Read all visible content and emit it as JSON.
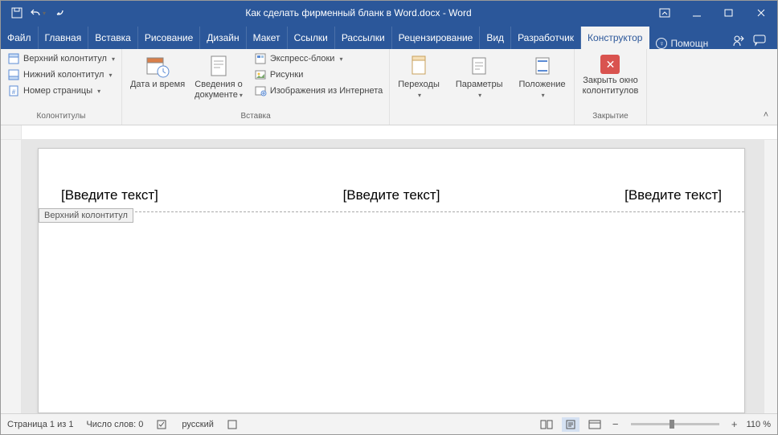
{
  "title": "Как сделать фирменный бланк в Word.docx  -  Word",
  "tabs": {
    "file": "Файл",
    "home": "Главная",
    "insert": "Вставка",
    "draw": "Рисование",
    "design": "Дизайн",
    "layout": "Макет",
    "refs": "Ссылки",
    "mail": "Рассылки",
    "review": "Рецензирование",
    "view": "Вид",
    "dev": "Разработчик",
    "constructor": "Конструктор"
  },
  "help_placeholder": "Помощн",
  "ribbon": {
    "hf": {
      "header": "Верхний колонтитул",
      "footer": "Нижний колонтитул",
      "pagenum": "Номер страницы",
      "group": "Колонтитулы"
    },
    "ins": {
      "datetime": "Дата и время",
      "docinfo": "Сведения о документе",
      "quick": "Экспресс-блоки",
      "pics": "Рисунки",
      "online": "Изображения из Интернета",
      "group": "Вставка"
    },
    "nav": {
      "goto": "Переходы",
      "params": "Параметры",
      "pos": "Положение"
    },
    "close": {
      "label1": "Закрыть окно",
      "label2": "колонтитулов",
      "group": "Закрытие"
    }
  },
  "doc": {
    "ph_left": "[Введите текст]",
    "ph_center": "[Введите текст]",
    "ph_right": "[Введите текст]",
    "hf_tag": "Верхний колонтитул"
  },
  "status": {
    "page": "Страница 1 из 1",
    "words": "Число слов: 0",
    "lang": "русский",
    "zoom": "110 %"
  }
}
